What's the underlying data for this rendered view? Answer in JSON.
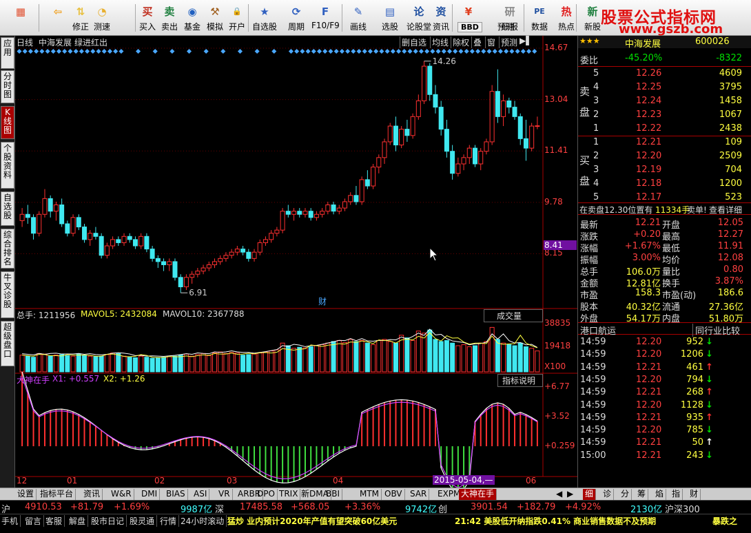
{
  "toolbar": {
    "buttons": [
      {
        "label": "",
        "icon": "windows-icon"
      },
      {
        "label": "",
        "icon": "back-arrow-icon"
      },
      {
        "label": "修正",
        "icon": "up-down-icon"
      },
      {
        "label": "测速",
        "icon": "clock-icon"
      },
      {
        "label": "买入",
        "icon": "buy-icon"
      },
      {
        "label": "卖出",
        "icon": "sell-icon"
      },
      {
        "label": "基金",
        "icon": "fund-icon"
      },
      {
        "label": "模拟",
        "icon": "hammer-icon"
      },
      {
        "label": "开户",
        "icon": "lock-icon"
      },
      {
        "label": "自选股",
        "icon": "star-icon"
      },
      {
        "label": "周期",
        "icon": "cycle-icon"
      },
      {
        "label": "F10/F9",
        "icon": "f10-icon"
      },
      {
        "label": "画线",
        "icon": "pen-icon"
      },
      {
        "label": "选股",
        "icon": "screen-icon"
      },
      {
        "label": "论股堂",
        "icon": "chat-icon"
      },
      {
        "label": "资讯",
        "icon": "news-icon"
      },
      {
        "label": "资金",
        "icon": "money-icon"
      },
      {
        "label": "研报",
        "icon": "report-icon"
      },
      {
        "label": "数据",
        "icon": "pe-icon"
      },
      {
        "label": "热点",
        "icon": "hot-icon"
      },
      {
        "label": "新股",
        "icon": "new-icon"
      }
    ],
    "sub_labels": {
      "bbd": "BBD",
      "forecast": "预测"
    },
    "watermark_cn": "股票公式指标网",
    "watermark_url": "www.gszb.com"
  },
  "left_tabs": [
    "应用",
    "分时图",
    "K线图",
    "个股资料",
    "自选股",
    "综合排名",
    "牛叉诊股",
    "超级盘口"
  ],
  "chart_header": {
    "period": "日线",
    "stock": "中海发展",
    "title": "绿进红出",
    "right_buttons": [
      "删自选",
      "均线",
      "除权",
      "叠",
      "窗",
      "预测"
    ]
  },
  "chart_data": {
    "type": "candlestick",
    "price_axis_ticks": [
      "14.67",
      "13.04",
      "11.41",
      "9.78",
      "8.15"
    ],
    "current_price_tag": "8.41",
    "high_label": "14.26",
    "low_label": "6.91",
    "finance_marker": "财",
    "x_ticks": [
      "12",
      "01",
      "02",
      "03",
      "04",
      "06"
    ],
    "date_cursor": "2015-05-04,—",
    "ylim": [
      6.5,
      14.67
    ],
    "candles": [
      [
        9.2,
        9.6,
        9.0,
        9.4
      ],
      [
        9.4,
        9.7,
        9.1,
        9.3
      ],
      [
        9.3,
        9.4,
        8.6,
        8.8
      ],
      [
        8.8,
        9.5,
        8.7,
        9.4
      ],
      [
        9.4,
        10.2,
        9.3,
        9.9
      ],
      [
        9.9,
        10.0,
        9.3,
        9.5
      ],
      [
        9.5,
        9.8,
        9.2,
        9.7
      ],
      [
        9.7,
        9.9,
        9.0,
        9.1
      ],
      [
        9.1,
        9.2,
        8.7,
        8.8
      ],
      [
        8.8,
        9.4,
        8.7,
        9.3
      ],
      [
        9.3,
        9.4,
        8.9,
        9.0
      ],
      [
        9.0,
        9.1,
        8.5,
        8.6
      ],
      [
        8.6,
        8.9,
        8.4,
        8.8
      ],
      [
        8.8,
        9.0,
        8.6,
        8.7
      ],
      [
        8.7,
        8.8,
        8.0,
        8.1
      ],
      [
        8.1,
        8.5,
        8.0,
        8.4
      ],
      [
        8.4,
        8.7,
        8.3,
        8.6
      ],
      [
        8.6,
        8.7,
        8.4,
        8.5
      ],
      [
        8.5,
        8.8,
        8.4,
        8.7
      ],
      [
        8.7,
        8.8,
        8.5,
        8.6
      ],
      [
        8.6,
        8.7,
        8.3,
        8.4
      ],
      [
        8.4,
        8.8,
        8.3,
        8.7
      ],
      [
        8.7,
        8.8,
        8.2,
        8.3
      ],
      [
        8.3,
        8.4,
        7.9,
        8.0
      ],
      [
        8.0,
        8.1,
        7.7,
        7.9
      ],
      [
        7.9,
        8.0,
        7.6,
        7.8
      ],
      [
        7.8,
        8.0,
        7.6,
        7.9
      ],
      [
        7.9,
        8.0,
        7.3,
        7.4
      ],
      [
        7.4,
        7.5,
        6.91,
        7.1
      ],
      [
        7.1,
        7.5,
        7.0,
        7.4
      ],
      [
        7.4,
        7.6,
        7.2,
        7.5
      ],
      [
        7.5,
        7.7,
        7.4,
        7.6
      ],
      [
        7.6,
        7.8,
        7.5,
        7.7
      ],
      [
        7.7,
        7.9,
        7.6,
        7.8
      ],
      [
        7.8,
        8.0,
        7.7,
        7.9
      ],
      [
        7.9,
        8.1,
        7.8,
        8.0
      ],
      [
        8.0,
        8.2,
        7.9,
        8.1
      ],
      [
        8.1,
        8.3,
        8.0,
        8.2
      ],
      [
        8.2,
        8.4,
        8.1,
        8.3
      ],
      [
        8.3,
        8.4,
        8.1,
        8.2
      ],
      [
        8.2,
        8.3,
        7.9,
        8.0
      ],
      [
        8.0,
        8.3,
        7.9,
        8.2
      ],
      [
        8.2,
        8.6,
        8.1,
        8.5
      ],
      [
        8.5,
        8.7,
        8.4,
        8.6
      ],
      [
        8.6,
        8.9,
        8.5,
        8.8
      ],
      [
        8.8,
        9.0,
        8.7,
        8.9
      ],
      [
        8.9,
        9.6,
        8.8,
        9.5
      ],
      [
        9.5,
        9.7,
        9.3,
        9.4
      ],
      [
        9.4,
        9.6,
        9.2,
        9.5
      ],
      [
        9.5,
        9.6,
        9.3,
        9.4
      ],
      [
        9.4,
        9.6,
        9.3,
        9.5
      ],
      [
        9.5,
        9.6,
        9.2,
        9.3
      ],
      [
        9.3,
        9.5,
        9.2,
        9.4
      ],
      [
        9.4,
        9.6,
        9.3,
        9.5
      ],
      [
        9.5,
        9.8,
        9.4,
        9.7
      ],
      [
        9.7,
        9.8,
        9.4,
        9.5
      ],
      [
        9.5,
        9.7,
        9.4,
        9.6
      ],
      [
        9.6,
        9.9,
        9.5,
        9.8
      ],
      [
        9.8,
        10.1,
        9.7,
        10.0
      ],
      [
        10.0,
        10.3,
        9.7,
        9.8
      ],
      [
        9.8,
        10.6,
        9.7,
        10.5
      ],
      [
        10.5,
        10.8,
        10.2,
        10.3
      ],
      [
        10.3,
        11.0,
        10.2,
        10.9
      ],
      [
        10.9,
        11.3,
        10.7,
        11.2
      ],
      [
        11.2,
        11.8,
        11.0,
        11.7
      ],
      [
        11.7,
        12.3,
        11.6,
        12.2
      ],
      [
        12.2,
        12.5,
        11.4,
        11.6
      ],
      [
        11.6,
        12.2,
        11.5,
        12.1
      ],
      [
        12.1,
        12.4,
        11.7,
        11.9
      ],
      [
        11.9,
        12.6,
        11.8,
        12.5
      ],
      [
        12.5,
        13.2,
        12.4,
        13.0
      ],
      [
        13.0,
        14.26,
        12.9,
        14.1
      ],
      [
        14.1,
        14.2,
        13.0,
        13.2
      ],
      [
        13.2,
        13.5,
        12.6,
        12.8
      ],
      [
        12.8,
        13.0,
        11.9,
        12.1
      ],
      [
        12.1,
        12.4,
        11.2,
        11.4
      ],
      [
        11.4,
        11.6,
        10.5,
        10.7
      ],
      [
        10.7,
        11.2,
        10.6,
        11.0
      ],
      [
        11.0,
        11.3,
        10.8,
        11.2
      ],
      [
        11.2,
        11.6,
        11.0,
        11.5
      ],
      [
        11.5,
        11.6,
        10.9,
        11.0
      ],
      [
        11.0,
        11.5,
        10.8,
        11.4
      ],
      [
        11.4,
        11.8,
        11.3,
        11.7
      ],
      [
        11.7,
        13.5,
        11.6,
        13.3
      ],
      [
        13.3,
        14.0,
        12.3,
        12.5
      ],
      [
        12.5,
        13.2,
        12.2,
        13.0
      ],
      [
        13.0,
        13.1,
        12.6,
        12.8
      ],
      [
        12.8,
        13.0,
        12.4,
        12.5
      ],
      [
        12.5,
        12.6,
        11.6,
        11.8
      ],
      [
        11.8,
        12.4,
        11.1,
        11.5
      ],
      [
        11.5,
        12.3,
        11.4,
        12.2
      ],
      [
        12.2,
        12.5,
        12.1,
        12.21
      ]
    ]
  },
  "volume": {
    "label": "总手: 1211956",
    "mavol5": "MAVOL5: 2432084",
    "mavol10": "MAVOL10: 2367788",
    "dropdown": "成交量",
    "ticks": [
      "38835",
      "19418",
      "X100"
    ]
  },
  "indicator": {
    "name": "大神在手",
    "x1": "X1: +0.557",
    "x2": "X2: +1.26",
    "help": "指标说明",
    "ticks": [
      "+6.77",
      "+3.52",
      "+0.259"
    ]
  },
  "right_panel": {
    "stars": "★★★",
    "stock_name": "中海发展",
    "code": "600026",
    "webi_label": "委比",
    "webi_pct": "-45.20%",
    "webi_diff": "-8322",
    "sell_label": "卖盘",
    "buy_label": "买盘",
    "sells": [
      [
        "5",
        "12.26",
        "4609"
      ],
      [
        "4",
        "12.25",
        "3795"
      ],
      [
        "3",
        "12.24",
        "1458"
      ],
      [
        "2",
        "12.23",
        "1067"
      ],
      [
        "1",
        "12.22",
        "2438"
      ]
    ],
    "buys": [
      [
        "1",
        "12.21",
        "109"
      ],
      [
        "2",
        "12.20",
        "2509"
      ],
      [
        "3",
        "12.19",
        "704"
      ],
      [
        "4",
        "12.18",
        "1200"
      ],
      [
        "5",
        "12.17",
        "523"
      ]
    ],
    "notice": "在卖盘12.30位置有",
    "notice_qty": "11334手",
    "notice_tail": "卖单!",
    "detail": "查看详细",
    "stats": [
      [
        "最新",
        "12.21",
        "开盘",
        "12.05"
      ],
      [
        "涨跌",
        "+0.20",
        "最高",
        "12.27"
      ],
      [
        "涨幅",
        "+1.67%",
        "最低",
        "11.91"
      ],
      [
        "振幅",
        "3.00%",
        "均价",
        "12.08"
      ],
      [
        "总手",
        "106.0万",
        "量比",
        "0.80"
      ],
      [
        "金额",
        "12.81亿",
        "换手",
        "3.87%"
      ],
      [
        "市盈",
        "158.3",
        "市盈(动)",
        "186.6"
      ],
      [
        "股本",
        "40.32亿",
        "流通",
        "27.36亿"
      ],
      [
        "外盘",
        "54.17万",
        "内盘",
        "51.80万"
      ]
    ],
    "industry": "港口航运",
    "compare": "同行业比较",
    "ticks": [
      [
        "14:59",
        "12.20",
        "952",
        "down"
      ],
      [
        "14:59",
        "12.20",
        "1206",
        "down"
      ],
      [
        "14:59",
        "12.21",
        "461",
        "up"
      ],
      [
        "14:59",
        "12.20",
        "794",
        "down"
      ],
      [
        "14:59",
        "12.21",
        "268",
        "up"
      ],
      [
        "14:59",
        "12.20",
        "1128",
        "down"
      ],
      [
        "14:59",
        "12.21",
        "935",
        "up"
      ],
      [
        "14:59",
        "12.20",
        "785",
        "down"
      ],
      [
        "14:59",
        "12.21",
        "50",
        "up-white"
      ],
      [
        "15:00",
        "12.21",
        "243",
        "down"
      ]
    ],
    "bottom_tabs": [
      "细",
      "诊",
      "分",
      "筹",
      "焰",
      "指",
      "财"
    ]
  },
  "indicator_tabs": [
    "设置",
    "指标平台",
    "资讯",
    "W&R",
    "DMI",
    "BIAS",
    "ASI",
    "VR",
    "ARBR",
    "DPO",
    "TRIX",
    "新DMA",
    "BBI",
    "MTM",
    "OBV",
    "SAR",
    "EXPMA",
    "大神在手"
  ],
  "status": {
    "sh_label": "沪",
    "sh_index": "4910.53",
    "sh_change": "+81.79",
    "sh_pct": "+1.69%",
    "sh_amount": "9987亿",
    "sz_label": "深",
    "sz_index": "17485.58",
    "sz_change": "+568.05",
    "sz_pct": "+3.36%",
    "sz_amount": "9742亿",
    "cy_label": "创",
    "cy_index": "3901.54",
    "cy_change": "+182.79",
    "cy_pct": "+4.92%",
    "hs_amount": "2130亿",
    "hs_label": "沪深300"
  },
  "footer": {
    "items": [
      "手机",
      "留言",
      "客服",
      "解盘",
      "股市日记",
      "股灵通",
      "行情",
      "24小时滚动"
    ],
    "news1": "猛炒 业内预计2020年产值有望突破60亿美元",
    "news2": "21:42 美股低开纳指跌0.41% 商业销售数据不及预期",
    "tail": "暴跌之"
  }
}
